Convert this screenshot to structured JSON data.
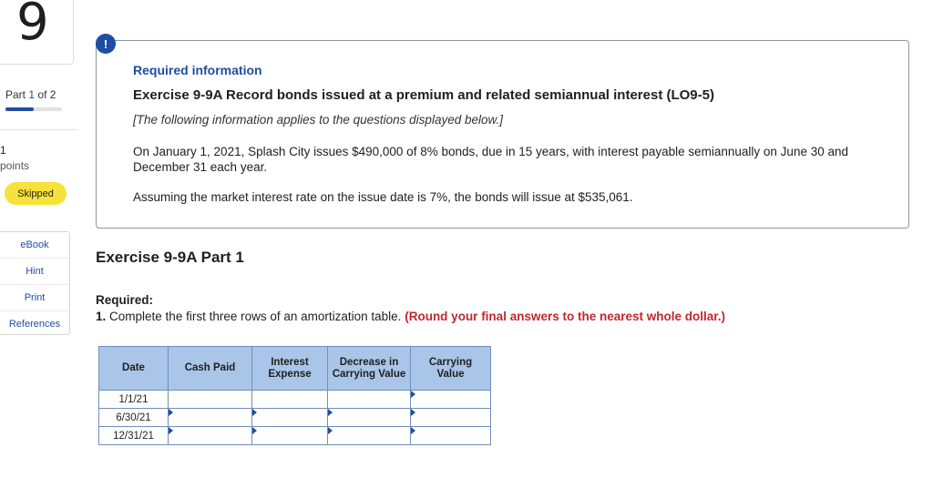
{
  "sidebar": {
    "question_number": "9",
    "part_prefix": "Part",
    "part_current": "1",
    "part_of": "of 2",
    "progress_fraction": 0.5,
    "points_value": "1",
    "points_label": "points",
    "status_badge": "Skipped",
    "tools": [
      {
        "label": "eBook"
      },
      {
        "label": "Hint"
      },
      {
        "label": "Print"
      },
      {
        "label": "References"
      }
    ]
  },
  "info": {
    "alert_icon": "!",
    "heading": "Required information",
    "exercise_title": "Exercise 9-9A Record bonds issued at a premium and related semiannual interest (LO9-5)",
    "applies_note": "[The following information applies to the questions displayed below.]",
    "paragraph1": "On January 1, 2021, Splash City issues $490,000 of 8% bonds, due in 15 years, with interest payable semiannually on June 30 and December 31 each year.",
    "paragraph2": "Assuming the market interest rate on the issue date is 7%, the bonds will issue at $535,061."
  },
  "main": {
    "part_title": "Exercise 9-9A Part 1",
    "required_label": "Required:",
    "instruction_number": "1.",
    "instruction_text": "Complete the first three rows of an amortization table.",
    "instruction_round": "(Round your final answers to the nearest whole dollar.)"
  },
  "table": {
    "headers": {
      "date": "Date",
      "cash_paid": "Cash Paid",
      "interest_expense": "Interest Expense",
      "decrease_carrying": "Decrease in Carrying Value",
      "carrying_value": "Carrying Value"
    },
    "rows": [
      {
        "date": "1/1/21",
        "cash_paid": "",
        "interest_expense": "",
        "decrease_carrying": "",
        "carrying_value": ""
      },
      {
        "date": "6/30/21",
        "cash_paid": "",
        "interest_expense": "",
        "decrease_carrying": "",
        "carrying_value": ""
      },
      {
        "date": "12/31/21",
        "cash_paid": "",
        "interest_expense": "",
        "decrease_carrying": "",
        "carrying_value": ""
      }
    ]
  },
  "colors": {
    "accent": "#1e4ea1",
    "warning_text": "#c0282d",
    "badge_yellow": "#f6e23a",
    "table_header": "#a9c5e8"
  }
}
